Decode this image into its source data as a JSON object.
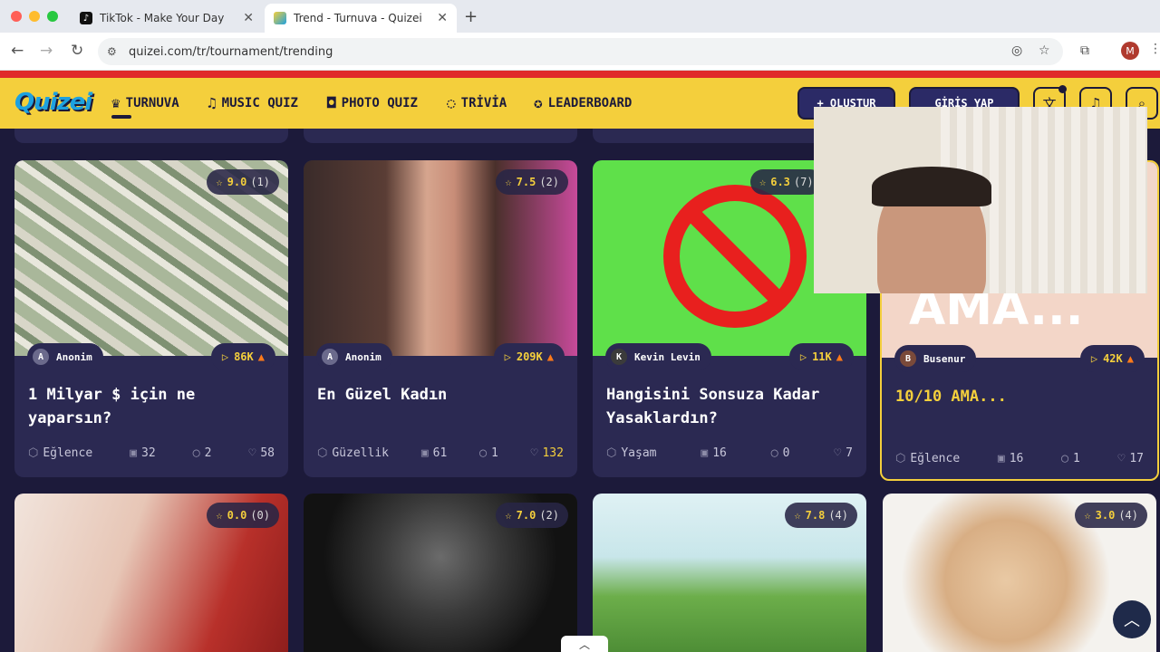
{
  "browser": {
    "tabs": [
      {
        "title": "TikTok - Make Your Day",
        "favicon": "tiktok-icon"
      },
      {
        "title": "Trend - Turnuva - Quizei",
        "favicon": "quizei-icon",
        "active": true
      }
    ],
    "url": "quizei.com/tr/tournament/trending",
    "profile_initial": "M"
  },
  "site": {
    "logo": "Quizei",
    "nav": [
      {
        "label": "TURNUVA",
        "icon": "trophy-icon",
        "active": true
      },
      {
        "label": "MUSIC QUIZ",
        "icon": "music-note-icon"
      },
      {
        "label": "PHOTO QUIZ",
        "icon": "camera-icon"
      },
      {
        "label": "TRİVİA",
        "icon": "chat-question-icon"
      },
      {
        "label": "LEADERBOARD",
        "icon": "medal-icon"
      }
    ],
    "create_label": "+ OLUŞTUR",
    "login_label": "GİRİŞ YAP"
  },
  "cards_row1": [
    {
      "rating": "9.0",
      "rating_count": "(1)",
      "author": "Anonim",
      "author_initial": "A",
      "plays": "86K",
      "title": "1 Milyar $ için ne yaparsın?",
      "category": "Eğlence",
      "images": "32",
      "comments": "2",
      "likes": "58"
    },
    {
      "rating": "7.5",
      "rating_count": "(2)",
      "author": "Anonim",
      "author_initial": "A",
      "plays": "209K",
      "title": "En Güzel Kadın",
      "category": "Güzellik",
      "images": "61",
      "comments": "1",
      "likes": "132",
      "liked": true
    },
    {
      "rating": "6.3",
      "rating_count": "(7)",
      "author": "Kevin Levin",
      "author_initial": "K",
      "plays": "11K",
      "title": "Hangisini Sonsuza Kadar Yasaklardın?",
      "category": "Yaşam",
      "images": "16",
      "comments": "0",
      "likes": "7"
    },
    {
      "rating": "",
      "rating_count": "",
      "author": "Busenur",
      "author_initial": "B",
      "plays": "42K",
      "title": "10/10 AMA...",
      "image_text": "AMA...",
      "category": "Eğlence",
      "images": "16",
      "comments": "1",
      "likes": "17",
      "highlighted": true
    }
  ],
  "cards_row2": [
    {
      "rating": "0.0",
      "rating_count": "(0)"
    },
    {
      "rating": "7.0",
      "rating_count": "(2)"
    },
    {
      "rating": "7.8",
      "rating_count": "(4)"
    },
    {
      "rating": "3.0",
      "rating_count": "(4)"
    }
  ],
  "colors": {
    "accent": "#f4cf3c",
    "card": "#2b2952",
    "background": "#1c1a3a",
    "brand_blue": "#1da1e0"
  }
}
